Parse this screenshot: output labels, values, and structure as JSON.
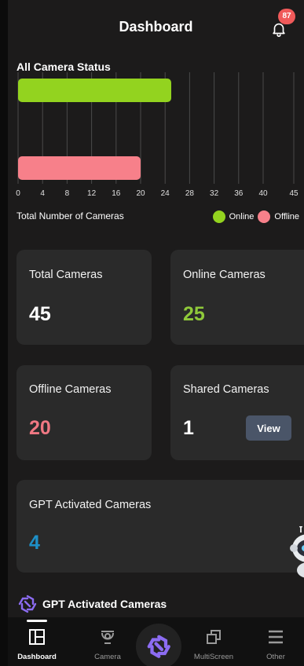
{
  "header": {
    "title": "Dashboard",
    "notification_count": "87"
  },
  "chart_data": {
    "type": "bar",
    "orientation": "horizontal",
    "title": "All Camera Status",
    "xlabel": "Total Number of Cameras",
    "categories": [
      "Online",
      "Offline"
    ],
    "values": [
      25,
      20
    ],
    "colors": [
      "#93d31f",
      "#f7808a"
    ],
    "xticks": [
      "0",
      "4",
      "8",
      "12",
      "16",
      "20",
      "24",
      "28",
      "32",
      "36",
      "40",
      "45"
    ],
    "xlim": [
      0,
      45
    ],
    "grid": true,
    "legend": {
      "placement": "bottom-right",
      "entries": [
        "Online",
        "Offline"
      ]
    }
  },
  "cards": {
    "total": {
      "label": "Total Cameras",
      "value": "45",
      "color": "#ffffff"
    },
    "online": {
      "label": "Online Cameras",
      "value": "25",
      "color": "#8fc93a"
    },
    "offline": {
      "label": "Offline Cameras",
      "value": "20",
      "color": "#f07883"
    },
    "shared": {
      "label": "Shared Cameras",
      "value": "1",
      "color": "#ffffff",
      "button": "View"
    },
    "gpt": {
      "label": "GPT Activated Cameras",
      "value": "4",
      "color": "#1e90c8"
    }
  },
  "gpt_section": {
    "title": "GPT Activated Cameras"
  },
  "nav": {
    "items": [
      {
        "label": "Dashboard",
        "icon": "dashboard-icon",
        "active": true
      },
      {
        "label": "Camera",
        "icon": "camera-icon",
        "active": false
      },
      {
        "label": "",
        "icon": "gpt-logo-icon",
        "active": false
      },
      {
        "label": "MultiScreen",
        "icon": "multiscreen-icon",
        "active": false
      },
      {
        "label": "Other",
        "icon": "menu-icon",
        "active": false
      }
    ]
  }
}
